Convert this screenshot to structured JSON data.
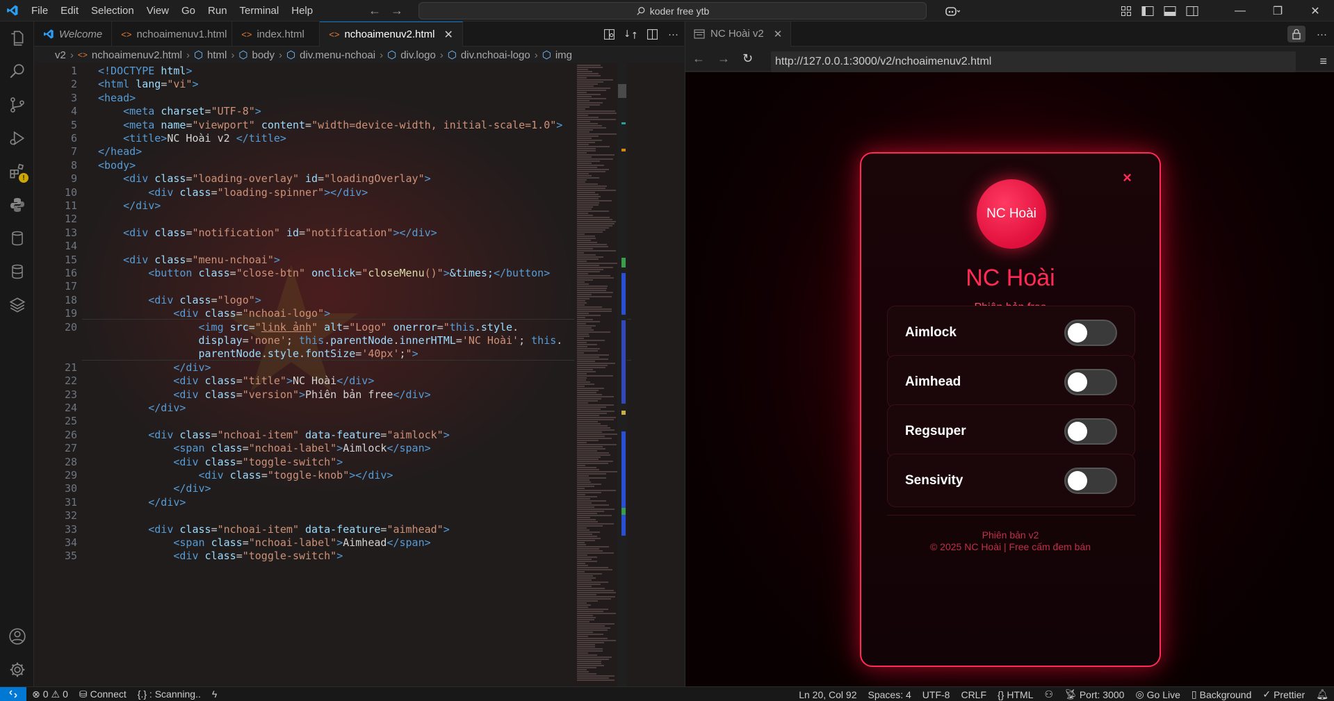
{
  "menubar": [
    "File",
    "Edit",
    "Selection",
    "View",
    "Go",
    "Run",
    "Terminal",
    "Help"
  ],
  "search": {
    "text": "koder free ytb"
  },
  "editor": {
    "tabs": [
      {
        "label": "Welcome",
        "active": false
      },
      {
        "label": "nchoaimenuv1.html",
        "active": false
      },
      {
        "label": "index.html",
        "active": false
      },
      {
        "label": "nchoaimenuv2.html",
        "active": true
      }
    ],
    "breadcrumb": [
      "v2",
      "nchoaimenuv2.html",
      "html",
      "body",
      "div.menu-nchoai",
      "div.logo",
      "div.nchoai-logo",
      "img"
    ],
    "lines": [
      {
        "n": "1",
        "html": "<span class='t-tag'>&lt;!DOCTYPE </span><span class='t-attr'>html</span><span class='t-tag'>&gt;</span>"
      },
      {
        "n": "2",
        "html": "<span class='t-tag'>&lt;html </span><span class='t-attr'>lang</span>=<span class='t-str'>\"vi\"</span><span class='t-tag'>&gt;</span>"
      },
      {
        "n": "3",
        "html": "<span class='t-tag'>&lt;head&gt;</span>"
      },
      {
        "n": "4",
        "html": "    <span class='t-tag'>&lt;meta </span><span class='t-attr'>charset</span>=<span class='t-str'>\"UTF-8\"</span><span class='t-tag'>&gt;</span>"
      },
      {
        "n": "5",
        "html": "    <span class='t-tag'>&lt;meta </span><span class='t-attr'>name</span>=<span class='t-str'>\"viewport\"</span> <span class='t-attr'>content</span>=<span class='t-str'>\"width=device-width, initial-scale=1.0\"</span><span class='t-tag'>&gt;</span>"
      },
      {
        "n": "6",
        "html": "    <span class='t-tag'>&lt;title&gt;</span><span class='t-txt'>NC Hoài v2 </span><span class='t-tag'>&lt;/title&gt;</span>"
      },
      {
        "n": "7",
        "html": "<span class='t-tag'>&lt;/head&gt;</span>"
      },
      {
        "n": "8",
        "html": "<span class='t-tag'>&lt;body&gt;</span>"
      },
      {
        "n": "9",
        "html": "    <span class='t-tag'>&lt;div </span><span class='t-attr'>class</span>=<span class='t-str'>\"loading-overlay\"</span> <span class='t-attr'>id</span>=<span class='t-str'>\"loadingOverlay\"</span><span class='t-tag'>&gt;</span>"
      },
      {
        "n": "10",
        "html": "        <span class='t-tag'>&lt;div </span><span class='t-attr'>class</span>=<span class='t-str'>\"loading-spinner\"</span><span class='t-tag'>&gt;&lt;/div&gt;</span>"
      },
      {
        "n": "11",
        "html": "    <span class='t-tag'>&lt;/div&gt;</span>"
      },
      {
        "n": "12",
        "html": ""
      },
      {
        "n": "13",
        "html": "    <span class='t-tag'>&lt;div </span><span class='t-attr'>class</span>=<span class='t-str'>\"notification\"</span> <span class='t-attr'>id</span>=<span class='t-str'>\"notification\"</span><span class='t-tag'>&gt;&lt;/div&gt;</span>"
      },
      {
        "n": "14",
        "html": ""
      },
      {
        "n": "15",
        "html": "    <span class='t-tag'>&lt;div </span><span class='t-attr'>class</span>=<span class='t-str'>\"menu-nchoai\"</span><span class='t-tag'>&gt;</span>"
      },
      {
        "n": "16",
        "html": "        <span class='t-tag'>&lt;button </span><span class='t-attr'>class</span>=<span class='t-str'>\"close-btn\"</span> <span class='t-attr'>onclick</span>=<span class='t-str'>\"</span><span class='t-fn'>closeMenu</span><span class='t-str'>()\"</span><span class='t-tag'>&gt;</span><span class='t-attr'>&amp;times;</span><span class='t-tag'>&lt;/button&gt;</span>"
      },
      {
        "n": "17",
        "html": ""
      },
      {
        "n": "18",
        "html": "        <span class='t-tag'>&lt;div </span><span class='t-attr'>class</span>=<span class='t-str'>\"logo\"</span><span class='t-tag'>&gt;</span>"
      },
      {
        "n": "19",
        "html": "            <span class='t-tag'>&lt;div </span><span class='t-attr'>class</span>=<span class='t-str'>\"nchoai-logo\"</span><span class='t-tag'>&gt;</span>"
      },
      {
        "n": "20",
        "html": "                <span class='t-tag'>&lt;img </span><span class='t-attr'>src</span>=<span class='t-str'>\"<u>link ảnh</u>\"</span> <span class='t-attr'>alt</span>=<span class='t-str'>\"Logo\"</span> <span class='t-attr'>onerror</span>=<span class='t-str'>\"</span><span class='t-tag'>this</span>.<span class='t-attr'>style</span>."
      },
      {
        "n": "",
        "html": "                <span class='t-attr'>display</span>=<span class='t-str'>'none'</span>; <span class='t-tag'>this</span>.<span class='t-attr'>parentNode</span>.<span class='t-attr'>innerHTML</span>=<span class='t-str'>'NC Hoài'</span>; <span class='t-tag'>this</span>."
      },
      {
        "n": "",
        "html": "                <span class='t-attr'>parentNode</span>.<span class='t-attr'>style</span>.<span class='t-attr'>fontSize</span>=<span class='t-str'>'40px'</span>;<span class='t-str'>\"</span><span class='t-tag'>&gt;</span>"
      },
      {
        "n": "21",
        "html": "            <span class='t-tag'>&lt;/div&gt;</span>"
      },
      {
        "n": "22",
        "html": "            <span class='t-tag'>&lt;div </span><span class='t-attr'>class</span>=<span class='t-str'>\"title\"</span><span class='t-tag'>&gt;</span><span class='t-txt'>NC Hoài</span><span class='t-tag'>&lt;/div&gt;</span>"
      },
      {
        "n": "23",
        "html": "            <span class='t-tag'>&lt;div </span><span class='t-attr'>class</span>=<span class='t-str'>\"version\"</span><span class='t-tag'>&gt;</span><span class='t-txt'>Phiên bản free</span><span class='t-tag'>&lt;/div&gt;</span>"
      },
      {
        "n": "24",
        "html": "        <span class='t-tag'>&lt;/div&gt;</span>"
      },
      {
        "n": "25",
        "html": ""
      },
      {
        "n": "26",
        "html": "        <span class='t-tag'>&lt;div </span><span class='t-attr'>class</span>=<span class='t-str'>\"nchoai-item\"</span> <span class='t-attr'>data-feature</span>=<span class='t-str'>\"aimlock\"</span><span class='t-tag'>&gt;</span>"
      },
      {
        "n": "27",
        "html": "            <span class='t-tag'>&lt;span </span><span class='t-attr'>class</span>=<span class='t-str'>\"nchoai-label\"</span><span class='t-tag'>&gt;</span><span class='t-txt'>Aimlock</span><span class='t-tag'>&lt;/span&gt;</span>"
      },
      {
        "n": "28",
        "html": "            <span class='t-tag'>&lt;div </span><span class='t-attr'>class</span>=<span class='t-str'>\"toggle-switch\"</span><span class='t-tag'>&gt;</span>"
      },
      {
        "n": "29",
        "html": "                <span class='t-tag'>&lt;div </span><span class='t-attr'>class</span>=<span class='t-str'>\"toggle-knob\"</span><span class='t-tag'>&gt;&lt;/div&gt;</span>"
      },
      {
        "n": "30",
        "html": "            <span class='t-tag'>&lt;/div&gt;</span>"
      },
      {
        "n": "31",
        "html": "        <span class='t-tag'>&lt;/div&gt;</span>"
      },
      {
        "n": "32",
        "html": ""
      },
      {
        "n": "33",
        "html": "        <span class='t-tag'>&lt;div </span><span class='t-attr'>class</span>=<span class='t-str'>\"nchoai-item\"</span> <span class='t-attr'>data-feature</span>=<span class='t-str'>\"aimhead\"</span><span class='t-tag'>&gt;</span>"
      },
      {
        "n": "34",
        "html": "            <span class='t-tag'>&lt;span </span><span class='t-attr'>class</span>=<span class='t-str'>\"nchoai-label\"</span><span class='t-tag'>&gt;</span><span class='t-txt'>Aimhead</span><span class='t-tag'>&lt;/span&gt;</span>"
      },
      {
        "n": "35",
        "html": "            <span class='t-tag'>&lt;div </span><span class='t-attr'>class</span>=<span class='t-str'>\"toggle-switch\"</span><span class='t-tag'>&gt;</span>"
      }
    ]
  },
  "browser": {
    "tab_label": "NC Hoài v2",
    "url": "http://127.0.0.1:3000/v2/nchoaimenuv2.html",
    "card": {
      "close": "×",
      "logo_text": "NC Hoài",
      "title": "NC Hoài",
      "version": "Phiên bản free",
      "features": [
        {
          "label": "Aimlock",
          "on": false
        },
        {
          "label": "Aimhead",
          "on": false
        },
        {
          "label": "Regsuper",
          "on": false
        },
        {
          "label": "Sensivity",
          "on": false
        }
      ],
      "footer_version": "Phiên bản v2",
      "footer_copy": "© 2025 NC Hoài | Free cấm đem bán"
    }
  },
  "statusbar": {
    "problems_errors": "0",
    "problems_warnings": "0",
    "connect": "Connect",
    "scanning": "{.} : Scanning..",
    "position": "Ln 20, Col 92",
    "spaces": "Spaces: 4",
    "encoding": "UTF-8",
    "eol": "CRLF",
    "language": "HTML",
    "port": "Port: 3000",
    "golive": "Go Live",
    "background": "Background",
    "prettier": "Prettier"
  }
}
